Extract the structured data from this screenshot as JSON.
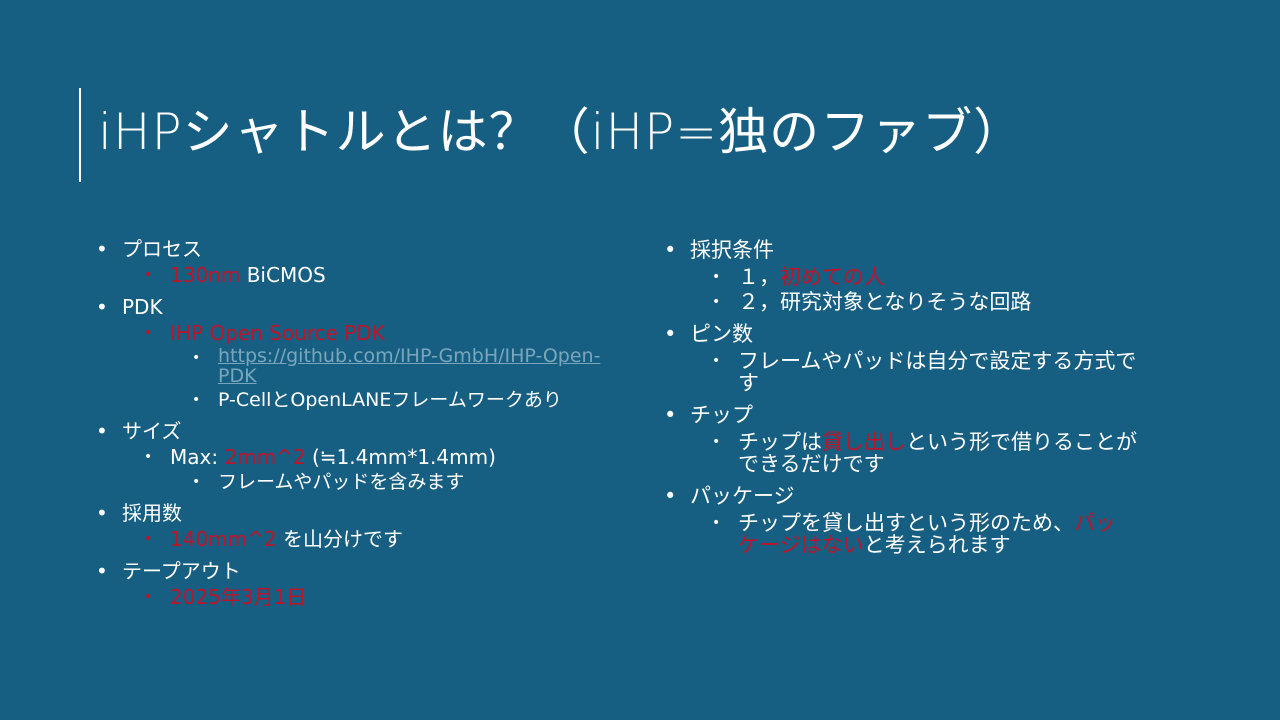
{
  "slide": {
    "title": "iHPシャトルとは？（iHP=独のファブ）"
  },
  "left": {
    "process": {
      "label": "プロセス",
      "value_red": "130nm",
      "value_rest": " BiCMOS"
    },
    "pdk": {
      "label": "PDK",
      "name_red": "IHP Open Source PDK",
      "link": "https://github.com/IHP-GmbH/IHP-Open-PDK",
      "link_line1": "https://github.com/IHP-GmbH/IHP-Open-",
      "link_line2": "PDK",
      "note": "P-CellとOpenLANEフレームワークあり"
    },
    "size": {
      "label": "サイズ",
      "max_prefix": "Max: ",
      "max_red": "2mm^2",
      "max_rest": " (≒1.4mm*1.4mm)",
      "note": "フレームやパッドを含みます"
    },
    "adoption": {
      "label": "採用数",
      "value_red": "140mm^2",
      "value_rest": " を山分けです"
    },
    "tapeout": {
      "label": "テープアウト",
      "date_red": "2025年3月1日"
    }
  },
  "right": {
    "criteria": {
      "label": "採択条件",
      "item1_prefix": "１，",
      "item1_red": "初めての人",
      "item2": "２，研究対象となりそうな回路"
    },
    "pins": {
      "label": "ピン数",
      "note_line1": "フレームやパッドは自分で設定する方式で",
      "note_line2": "す"
    },
    "chip": {
      "label": "チップ",
      "line1_a": "チップは",
      "line1_red": "貸し出し",
      "line1_b": "という形で借りることが",
      "line2": "できるだけです"
    },
    "package": {
      "label": "パッケージ",
      "line1_a": "チップを貸し出すという形のため、",
      "line1_red": "パッ",
      "line2_red": "ケージはない",
      "line2_b": "と考えられます"
    }
  },
  "colors": {
    "background": "#175f82",
    "text": "#ffffff",
    "accent_red": "#c0142a",
    "link": "#7aa6bd"
  }
}
